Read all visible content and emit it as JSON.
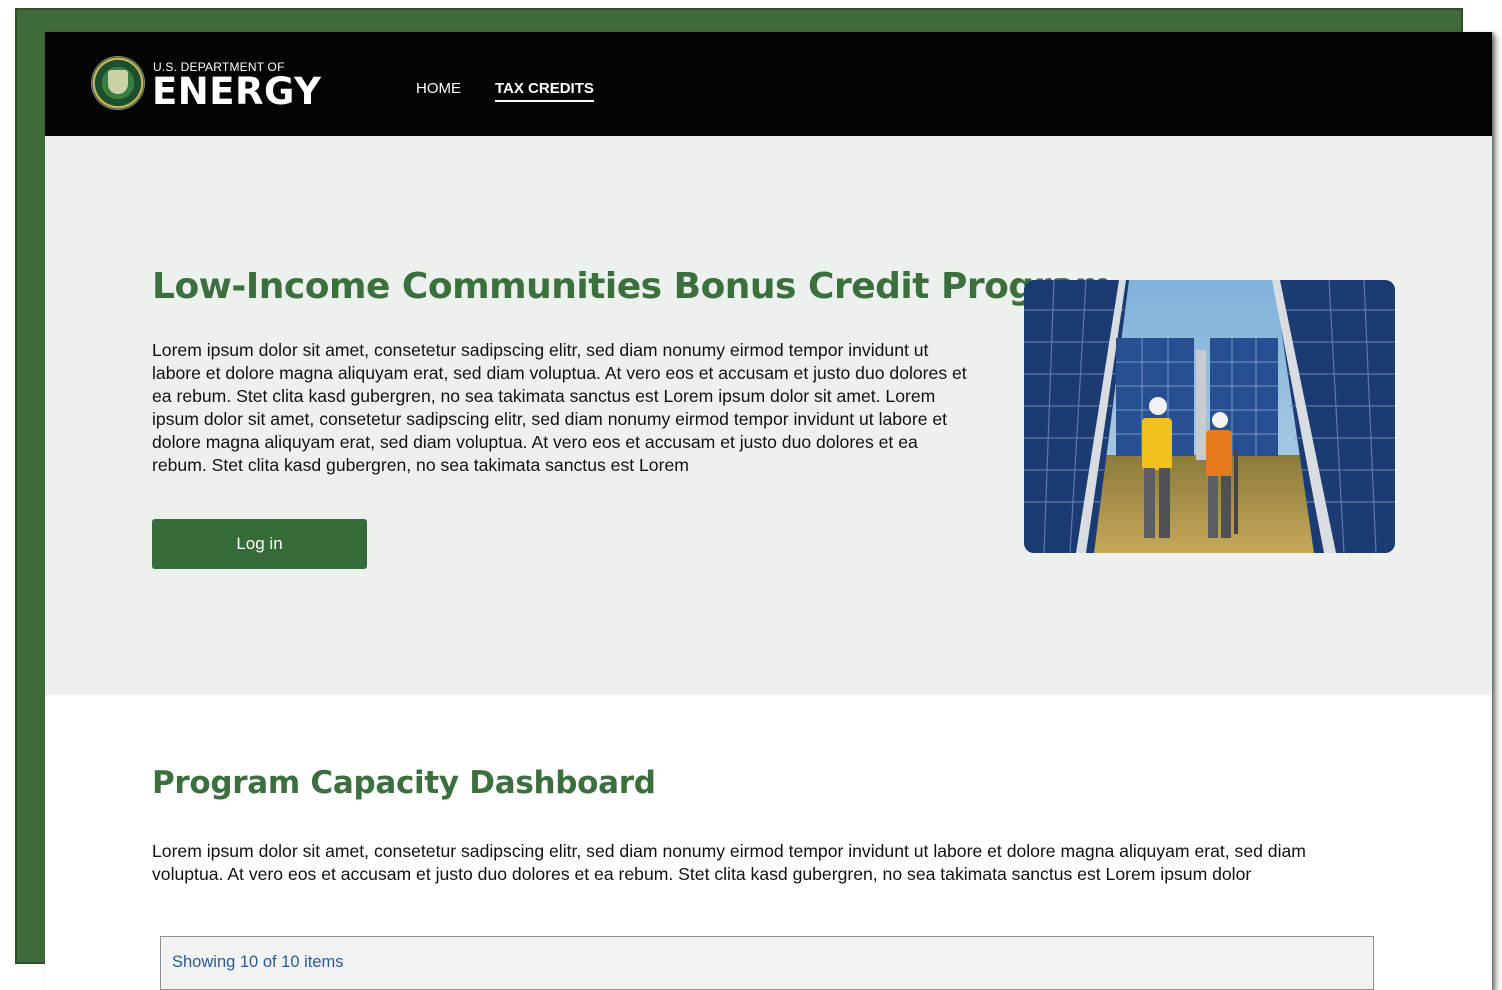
{
  "header": {
    "brand_top": "U.S. DEPARTMENT OF",
    "brand_main": "ENERGY",
    "nav": [
      {
        "label": "HOME",
        "active": false
      },
      {
        "label": "TAX CREDITS",
        "active": true
      }
    ]
  },
  "hero": {
    "title": "Low-Income Communities Bonus Credit Program",
    "body": "Lorem ipsum dolor sit amet, consetetur sadipscing elitr, sed diam nonumy eirmod tempor invidunt ut labore et dolore magna aliquyam erat, sed diam voluptua. At vero eos et accusam et justo duo dolores et ea rebum. Stet clita kasd gubergren, no sea takimata sanctus est Lorem ipsum dolor sit amet. Lorem ipsum dolor sit amet, consetetur sadipscing elitr, sed diam nonumy eirmod tempor invidunt ut labore et dolore magna aliquyam erat, sed diam voluptua. At vero eos et accusam et justo duo dolores et ea rebum. Stet clita kasd gubergren, no sea takimata sanctus est Lorem",
    "login_label": "Log in"
  },
  "dashboard": {
    "title": "Program Capacity Dashboard",
    "body": "Lorem ipsum dolor sit amet, consetetur sadipscing elitr, sed diam nonumy eirmod tempor invidunt ut labore et dolore magna aliquyam erat, sed diam voluptua. At vero eos et accusam et justo duo dolores et ea rebum. Stet clita kasd gubergren, no sea takimata sanctus est Lorem ipsum dolor",
    "items_status": "Showing 10 of 10 items"
  },
  "colors": {
    "brand_green": "#3b6f3e",
    "button_green": "#356b38",
    "header_bg": "#040404",
    "hero_bg": "#edf1ee",
    "link_blue": "#2b5a9a"
  }
}
